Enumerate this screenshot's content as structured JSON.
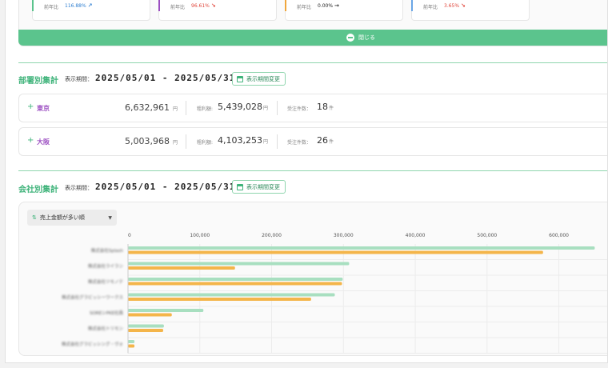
{
  "kpis": [
    {
      "label": "前年比",
      "value": "116.88%",
      "trend": "up",
      "color": "#2f7fd1",
      "accent": "#5bc48d"
    },
    {
      "label": "前年比",
      "value": "96.61%",
      "trend": "down",
      "color": "#e0453a",
      "accent": "#9b4ec1"
    },
    {
      "label": "前年比",
      "value": "0.00%",
      "trend": "flat",
      "color": "#222222",
      "accent": "#f0a63c"
    },
    {
      "label": "前年比",
      "value": "3.65%",
      "trend": "down",
      "color": "#e0453a",
      "accent": "#6aa6e6"
    }
  ],
  "close_label": "閉じる",
  "dept": {
    "title": "部署別集計",
    "period_label": "表示期間：",
    "period_value": "2025/05/01 - 2025/05/31",
    "period_button": "表示期間変更",
    "rows": [
      {
        "name": "東京",
        "sales": "6,632,961",
        "sales_unit": "円",
        "profit_label": "粗利額:",
        "profit": "5,439,028",
        "profit_unit": "円",
        "orders_label": "受注件数：",
        "orders": "18",
        "orders_unit": "件"
      },
      {
        "name": "大阪",
        "sales": "5,003,968",
        "sales_unit": "円",
        "profit_label": "粗利額:",
        "profit": "4,103,253",
        "profit_unit": "円",
        "orders_label": "受注件数：",
        "orders": "26",
        "orders_unit": "件"
      }
    ]
  },
  "company": {
    "title": "会社別集計",
    "period_label": "表示期間：",
    "period_value": "2025/05/01 - 2025/05/31",
    "period_button": "表示期間変更",
    "sort_label": "売上金額が多い順"
  },
  "chart_data": {
    "type": "bar",
    "orientation": "horizontal",
    "categories": [
      "株式会社Splash",
      "株式会社ライラン",
      "株式会社ツモノテ",
      "株式会社グラビッシーワークス",
      "SOREシPKE社員",
      "株式会社トリモン",
      "株式会社グラビッシング・ヴォ"
    ],
    "series": [
      {
        "color": "#a8dfc0",
        "values": [
          650000,
          308000,
          299000,
          288000,
          105000,
          50000,
          9000
        ]
      },
      {
        "color": "#f4b54a",
        "values": [
          578000,
          149000,
          298000,
          255000,
          61000,
          49000,
          9000
        ]
      }
    ],
    "xticks": [
      "0",
      "100,000",
      "200,000",
      "300,000",
      "400,000",
      "500,000",
      "600,000"
    ],
    "xlim": [
      0,
      650000
    ]
  }
}
